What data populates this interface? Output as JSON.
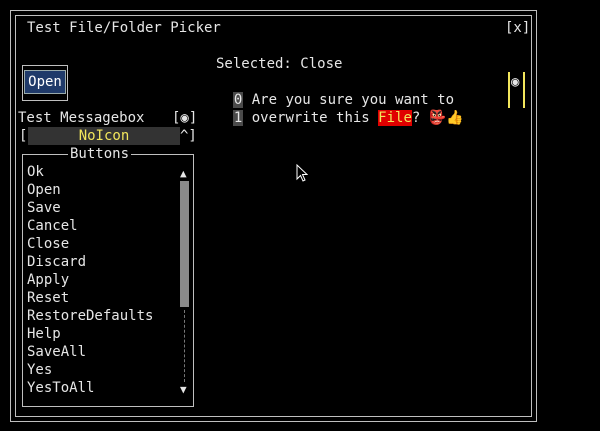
{
  "window": {
    "title": "Test File/Folder Picker",
    "close_label": "[x]"
  },
  "open_button": {
    "label": "Open"
  },
  "messagebox": {
    "label": "Test Messagebox",
    "checkbox": "[◉]"
  },
  "combo": {
    "left_bracket": "[",
    "value": "NoIcon",
    "right_mark": "^]"
  },
  "buttons_list": {
    "legend": "Buttons",
    "items": [
      "Ok",
      "Open",
      "Save",
      "Cancel",
      "Close",
      "Discard",
      "Apply",
      "Reset",
      "RestoreDefaults",
      "Help",
      "SaveAll",
      "Yes",
      "YesToAll"
    ],
    "scroll_up": "▲",
    "scroll_down": "▼"
  },
  "selected": {
    "text": "Selected: Close"
  },
  "preview": {
    "line0_num": "0",
    "line0_text": "Are you sure you want to",
    "line1_num": "1",
    "line1_pre": "overwrite this ",
    "line1_hl": "File",
    "line1_post": "? 👺👍"
  },
  "radio": {
    "glyph": "◉"
  }
}
